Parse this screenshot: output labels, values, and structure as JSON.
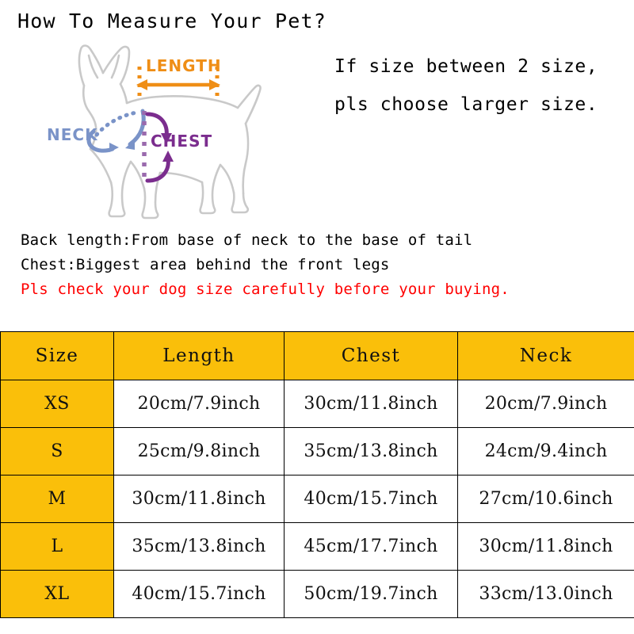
{
  "page": {
    "title": "How To Measure Your Pet?",
    "background_color": "#ffffff"
  },
  "note": {
    "line1": "If size between 2 size,",
    "line2": "pls choose larger size."
  },
  "illustration": {
    "labels": {
      "length": "LENGTH",
      "neck": "NECK",
      "chest": "CHEST"
    },
    "colors": {
      "dog_outline": "#c9c9c9",
      "length": "#ef8e16",
      "neck": "#7a93c8",
      "chest": "#7b2d8e"
    }
  },
  "description": {
    "line1": "Back length:From base of neck to the base of tail",
    "line2": "Chest:Biggest area behind the front legs",
    "warning": "Pls check your dog size carefully before your buying.",
    "warning_color": "#ff0000"
  },
  "table": {
    "accent_color": "#FABF0A",
    "headers": [
      "Size",
      "Length",
      "Chest",
      "Neck"
    ],
    "rows": [
      {
        "size": "XS",
        "length": "20cm/7.9inch",
        "chest": "30cm/11.8inch",
        "neck": "20cm/7.9inch"
      },
      {
        "size": "S",
        "length": "25cm/9.8inch",
        "chest": "35cm/13.8inch",
        "neck": "24cm/9.4inch"
      },
      {
        "size": "M",
        "length": "30cm/11.8inch",
        "chest": "40cm/15.7inch",
        "neck": "27cm/10.6inch"
      },
      {
        "size": "L",
        "length": "35cm/13.8inch",
        "chest": "45cm/17.7inch",
        "neck": "30cm/11.8inch"
      },
      {
        "size": "XL",
        "length": "40cm/15.7inch",
        "chest": "50cm/19.7inch",
        "neck": "33cm/13.0inch"
      }
    ]
  }
}
